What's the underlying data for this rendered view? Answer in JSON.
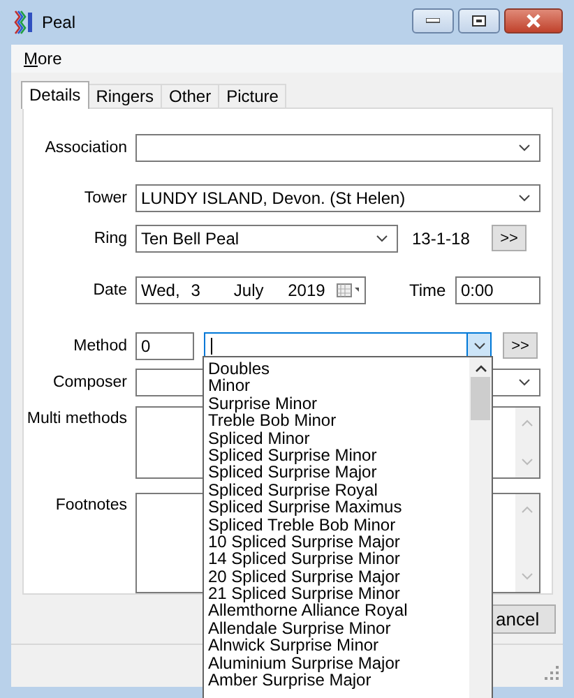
{
  "window": {
    "title": "Peal"
  },
  "menu": [
    {
      "label": "More"
    }
  ],
  "tabs": [
    {
      "label": "Details",
      "selected": true
    },
    {
      "label": "Ringers",
      "selected": false
    },
    {
      "label": "Other",
      "selected": false
    },
    {
      "label": "Picture",
      "selected": false
    }
  ],
  "form": {
    "association": {
      "label": "Association"
    },
    "tower": {
      "label": "Tower",
      "value": "LUNDY ISLAND, Devon. (St Helen)"
    },
    "ring": {
      "label": "Ring",
      "value": "Ten Bell Peal",
      "tenor": "13-1-18",
      "button": ">>"
    },
    "date": {
      "label": "Date",
      "weekday": "Wed,",
      "day": "3",
      "month": "July",
      "year": "2019"
    },
    "time": {
      "label": "Time",
      "value": "0:00"
    },
    "method": {
      "label": "Method",
      "number": "0",
      "button": ">>"
    },
    "composer": {
      "label": "Composer"
    },
    "multi_methods": {
      "label": "Multi methods"
    },
    "footnotes": {
      "label": "Footnotes"
    }
  },
  "buttons": [
    {
      "label": "ancel"
    }
  ],
  "method_dropdown": {
    "items": [
      "Doubles",
      "Minor",
      "Surprise Minor",
      "Treble Bob Minor",
      "Spliced Minor",
      "Spliced Surprise Minor",
      "Spliced Surprise Major",
      "Spliced Surprise Royal",
      "Spliced Surprise Maximus",
      "Spliced Treble Bob Minor",
      "10 Spliced Surprise Major",
      "14 Spliced Surprise Minor",
      "20 Spliced Surprise Major",
      "21 Spliced Surprise Minor",
      "Allemthorne Alliance Royal",
      "Allendale Surprise Minor",
      "Alnwick Surprise Minor",
      "Aluminium Surprise Major",
      "Amber Surprise Major"
    ]
  }
}
